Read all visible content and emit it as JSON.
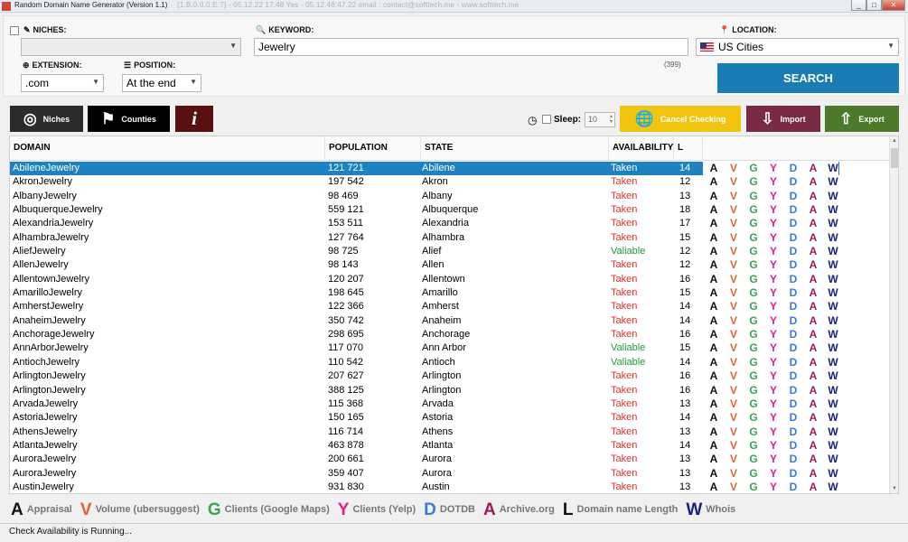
{
  "titlebar": {
    "title": "Random Domain Name Generator (Version 1.1)",
    "extra": "(1.B.0.0.0.E.7)  -  05.12.22 17:48  Yes  -  05.12.48:47.22 email : contact@softtech.me  -  www.softtech.me",
    "min": "_",
    "max": "□",
    "close": "✕"
  },
  "niches": {
    "label": "NICHES:",
    "value": ""
  },
  "keyword": {
    "label": "KEYWORD:",
    "value": "Jewelry",
    "count": "(399)"
  },
  "location": {
    "label": "LOCATION:",
    "value": "US Cities"
  },
  "extension": {
    "label": "EXTENSION:",
    "value": ".com"
  },
  "position": {
    "label": "POSITION:",
    "value": "At the end"
  },
  "search_button": "SEARCH",
  "toolbar": {
    "niches": "Niches",
    "counties": "Counties",
    "info": "i",
    "sleep_label": "Sleep:",
    "sleep_value": "10",
    "cancel_checking": "Cancel Checking",
    "import": "Import",
    "export": "Export"
  },
  "colors": {
    "accent": "#1b7cb3",
    "dark": "#2b2b2b",
    "black": "#000000",
    "maroon": "#5a1010",
    "cancel": "#f1c40f",
    "import": "#7a2a45",
    "export": "#4d7a2a",
    "taken": "#e0302a",
    "valid": "#1f9a3a"
  },
  "table": {
    "headers": {
      "domain": "DOMAIN",
      "population": "POPULATION",
      "state": "STATE",
      "availability": "AVAILABILITY",
      "length": "L"
    },
    "letters": [
      "A",
      "V",
      "G",
      "Y",
      "D",
      "A",
      "W"
    ],
    "letter_colors": [
      "#111111",
      "#e8612c",
      "#34a853",
      "#e0218a",
      "#3a7bd5",
      "#a0175a",
      "#1a237e"
    ],
    "rows": [
      {
        "domain": "AbileneJewelry",
        "population": "121 721",
        "state": "Abilene",
        "availability": "Taken",
        "length": "14"
      },
      {
        "domain": "AkronJewelry",
        "population": "197 542",
        "state": "Akron",
        "availability": "Taken",
        "length": "12"
      },
      {
        "domain": "AlbanyJewelry",
        "population": "98 469",
        "state": "Albany",
        "availability": "Taken",
        "length": "13"
      },
      {
        "domain": "AlbuquerqueJewelry",
        "population": "559 121",
        "state": "Albuquerque",
        "availability": "Taken",
        "length": "18"
      },
      {
        "domain": "AlexandriaJewelry",
        "population": "153 511",
        "state": "Alexandria",
        "availability": "Taken",
        "length": "17"
      },
      {
        "domain": "AlhambraJewelry",
        "population": "127 764",
        "state": "Alhambra",
        "availability": "Taken",
        "length": "15"
      },
      {
        "domain": "AliefJewelry",
        "population": "98 725",
        "state": "Alief",
        "availability": "Valiable",
        "length": "12"
      },
      {
        "domain": "AllenJewelry",
        "population": "98 143",
        "state": "Allen",
        "availability": "Taken",
        "length": "12"
      },
      {
        "domain": "AllentownJewelry",
        "population": "120 207",
        "state": "Allentown",
        "availability": "Taken",
        "length": "16"
      },
      {
        "domain": "AmarilloJewelry",
        "population": "198 645",
        "state": "Amarillo",
        "availability": "Taken",
        "length": "15"
      },
      {
        "domain": "AmherstJewelry",
        "population": "122 366",
        "state": "Amherst",
        "availability": "Taken",
        "length": "14"
      },
      {
        "domain": "AnaheimJewelry",
        "population": "350 742",
        "state": "Anaheim",
        "availability": "Taken",
        "length": "14"
      },
      {
        "domain": "AnchorageJewelry",
        "population": "298 695",
        "state": "Anchorage",
        "availability": "Taken",
        "length": "16"
      },
      {
        "domain": "AnnArborJewelry",
        "population": "117 070",
        "state": "Ann Arbor",
        "availability": "Valiable",
        "length": "15"
      },
      {
        "domain": "AntiochJewelry",
        "population": "110 542",
        "state": "Antioch",
        "availability": "Valiable",
        "length": "14"
      },
      {
        "domain": "ArlingtonJewelry",
        "population": "207 627",
        "state": "Arlington",
        "availability": "Taken",
        "length": "16"
      },
      {
        "domain": "ArlingtonJewelry",
        "population": "388 125",
        "state": "Arlington",
        "availability": "Taken",
        "length": "16"
      },
      {
        "domain": "ArvadaJewelry",
        "population": "115 368",
        "state": "Arvada",
        "availability": "Taken",
        "length": "13"
      },
      {
        "domain": "AstoriaJewelry",
        "population": "150 165",
        "state": "Astoria",
        "availability": "Taken",
        "length": "14"
      },
      {
        "domain": "AthensJewelry",
        "population": "116 714",
        "state": "Athens",
        "availability": "Taken",
        "length": "13"
      },
      {
        "domain": "AtlantaJewelry",
        "population": "463 878",
        "state": "Atlanta",
        "availability": "Taken",
        "length": "14"
      },
      {
        "domain": "AuroraJewelry",
        "population": "200 661",
        "state": "Aurora",
        "availability": "Taken",
        "length": "13"
      },
      {
        "domain": "AuroraJewelry",
        "population": "359 407",
        "state": "Aurora",
        "availability": "Taken",
        "length": "13"
      },
      {
        "domain": "AustinJewelry",
        "population": "931 830",
        "state": "Austin",
        "availability": "Taken",
        "length": "13"
      }
    ]
  },
  "legend": [
    {
      "letter": "A",
      "label": "Appraisal",
      "color": "#111111"
    },
    {
      "letter": "V",
      "label": "Volume (ubersuggest)",
      "color": "#e8612c"
    },
    {
      "letter": "G",
      "label": "Clients (Google Maps)",
      "color": "#34a853"
    },
    {
      "letter": "Y",
      "label": "Clients (Yelp)",
      "color": "#e0218a"
    },
    {
      "letter": "D",
      "label": "DOTDB",
      "color": "#3a7bd5"
    },
    {
      "letter": "A",
      "label": "Archive.org",
      "color": "#a0175a"
    },
    {
      "letter": "L",
      "label": "Domain name Length",
      "color": "#111111"
    },
    {
      "letter": "W",
      "label": "Whois",
      "color": "#1a237e"
    }
  ],
  "status": "Check Availability is Running..."
}
